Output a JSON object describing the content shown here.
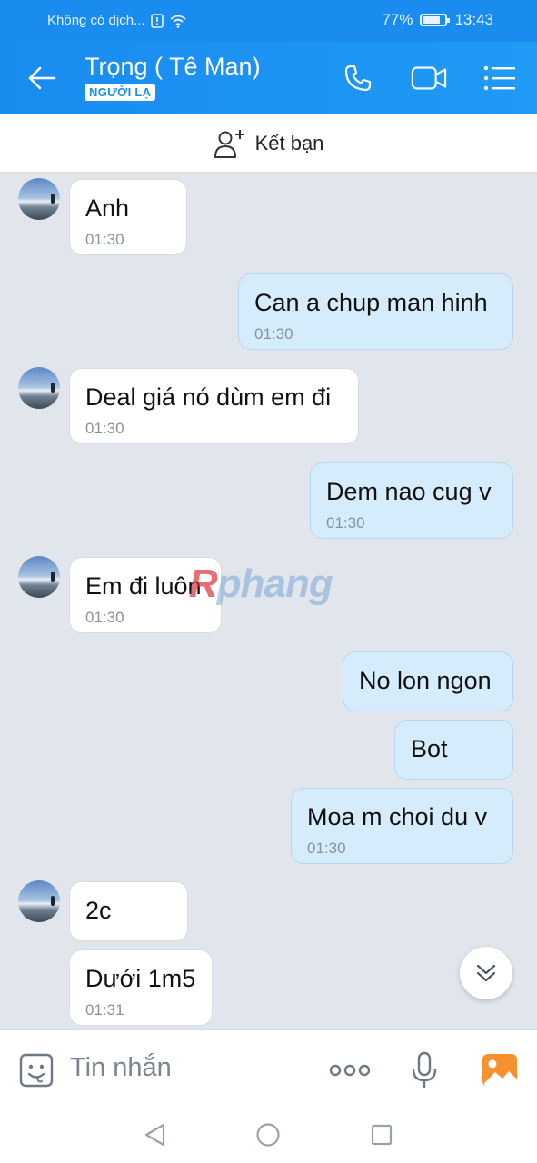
{
  "status_bar": {
    "carrier": "Không có dịch...",
    "battery_percent": "77%",
    "battery_level": 0.77,
    "time": "13:43"
  },
  "header": {
    "title": "Trọng ( Tê Man)",
    "badge": "NGƯỜI LẠ",
    "icons": [
      "back-arrow-icon",
      "phone-icon",
      "video-call-icon",
      "menu-list-icon"
    ]
  },
  "add_friend": {
    "label": "Kết bạn",
    "icon": "add-person-icon"
  },
  "messages": [
    {
      "side": "in",
      "text": "Anh",
      "time": "01:30"
    },
    {
      "side": "out",
      "text": "Can a chup man hinh",
      "time": "01:30"
    },
    {
      "side": "in",
      "text": "Deal giá nó dùm em đi",
      "time": "01:30"
    },
    {
      "side": "out",
      "text": "Dem nao cug v",
      "time": "01:30"
    },
    {
      "side": "in",
      "text": "Em đi luôn",
      "time": "01:30"
    },
    {
      "side": "out",
      "text": "No lon ngon",
      "time": ""
    },
    {
      "side": "out",
      "text": "Bot",
      "time": ""
    },
    {
      "side": "out",
      "text": "Moa m choi du v",
      "time": "01:30"
    },
    {
      "side": "in",
      "text": "2c",
      "time": ""
    },
    {
      "side": "in",
      "text": "Dưới 1m5",
      "time": "01:31"
    }
  ],
  "watermark": {
    "first": "R",
    "rest": "phang"
  },
  "input": {
    "placeholder": "Tin nhắn",
    "icons": [
      "sticker-icon",
      "more-dots-icon",
      "microphone-icon",
      "image-icon"
    ]
  },
  "colors": {
    "accent": "#1a8cf0",
    "outgoing_bubble": "#d4ecfb",
    "chat_background": "#e1e6ec"
  }
}
